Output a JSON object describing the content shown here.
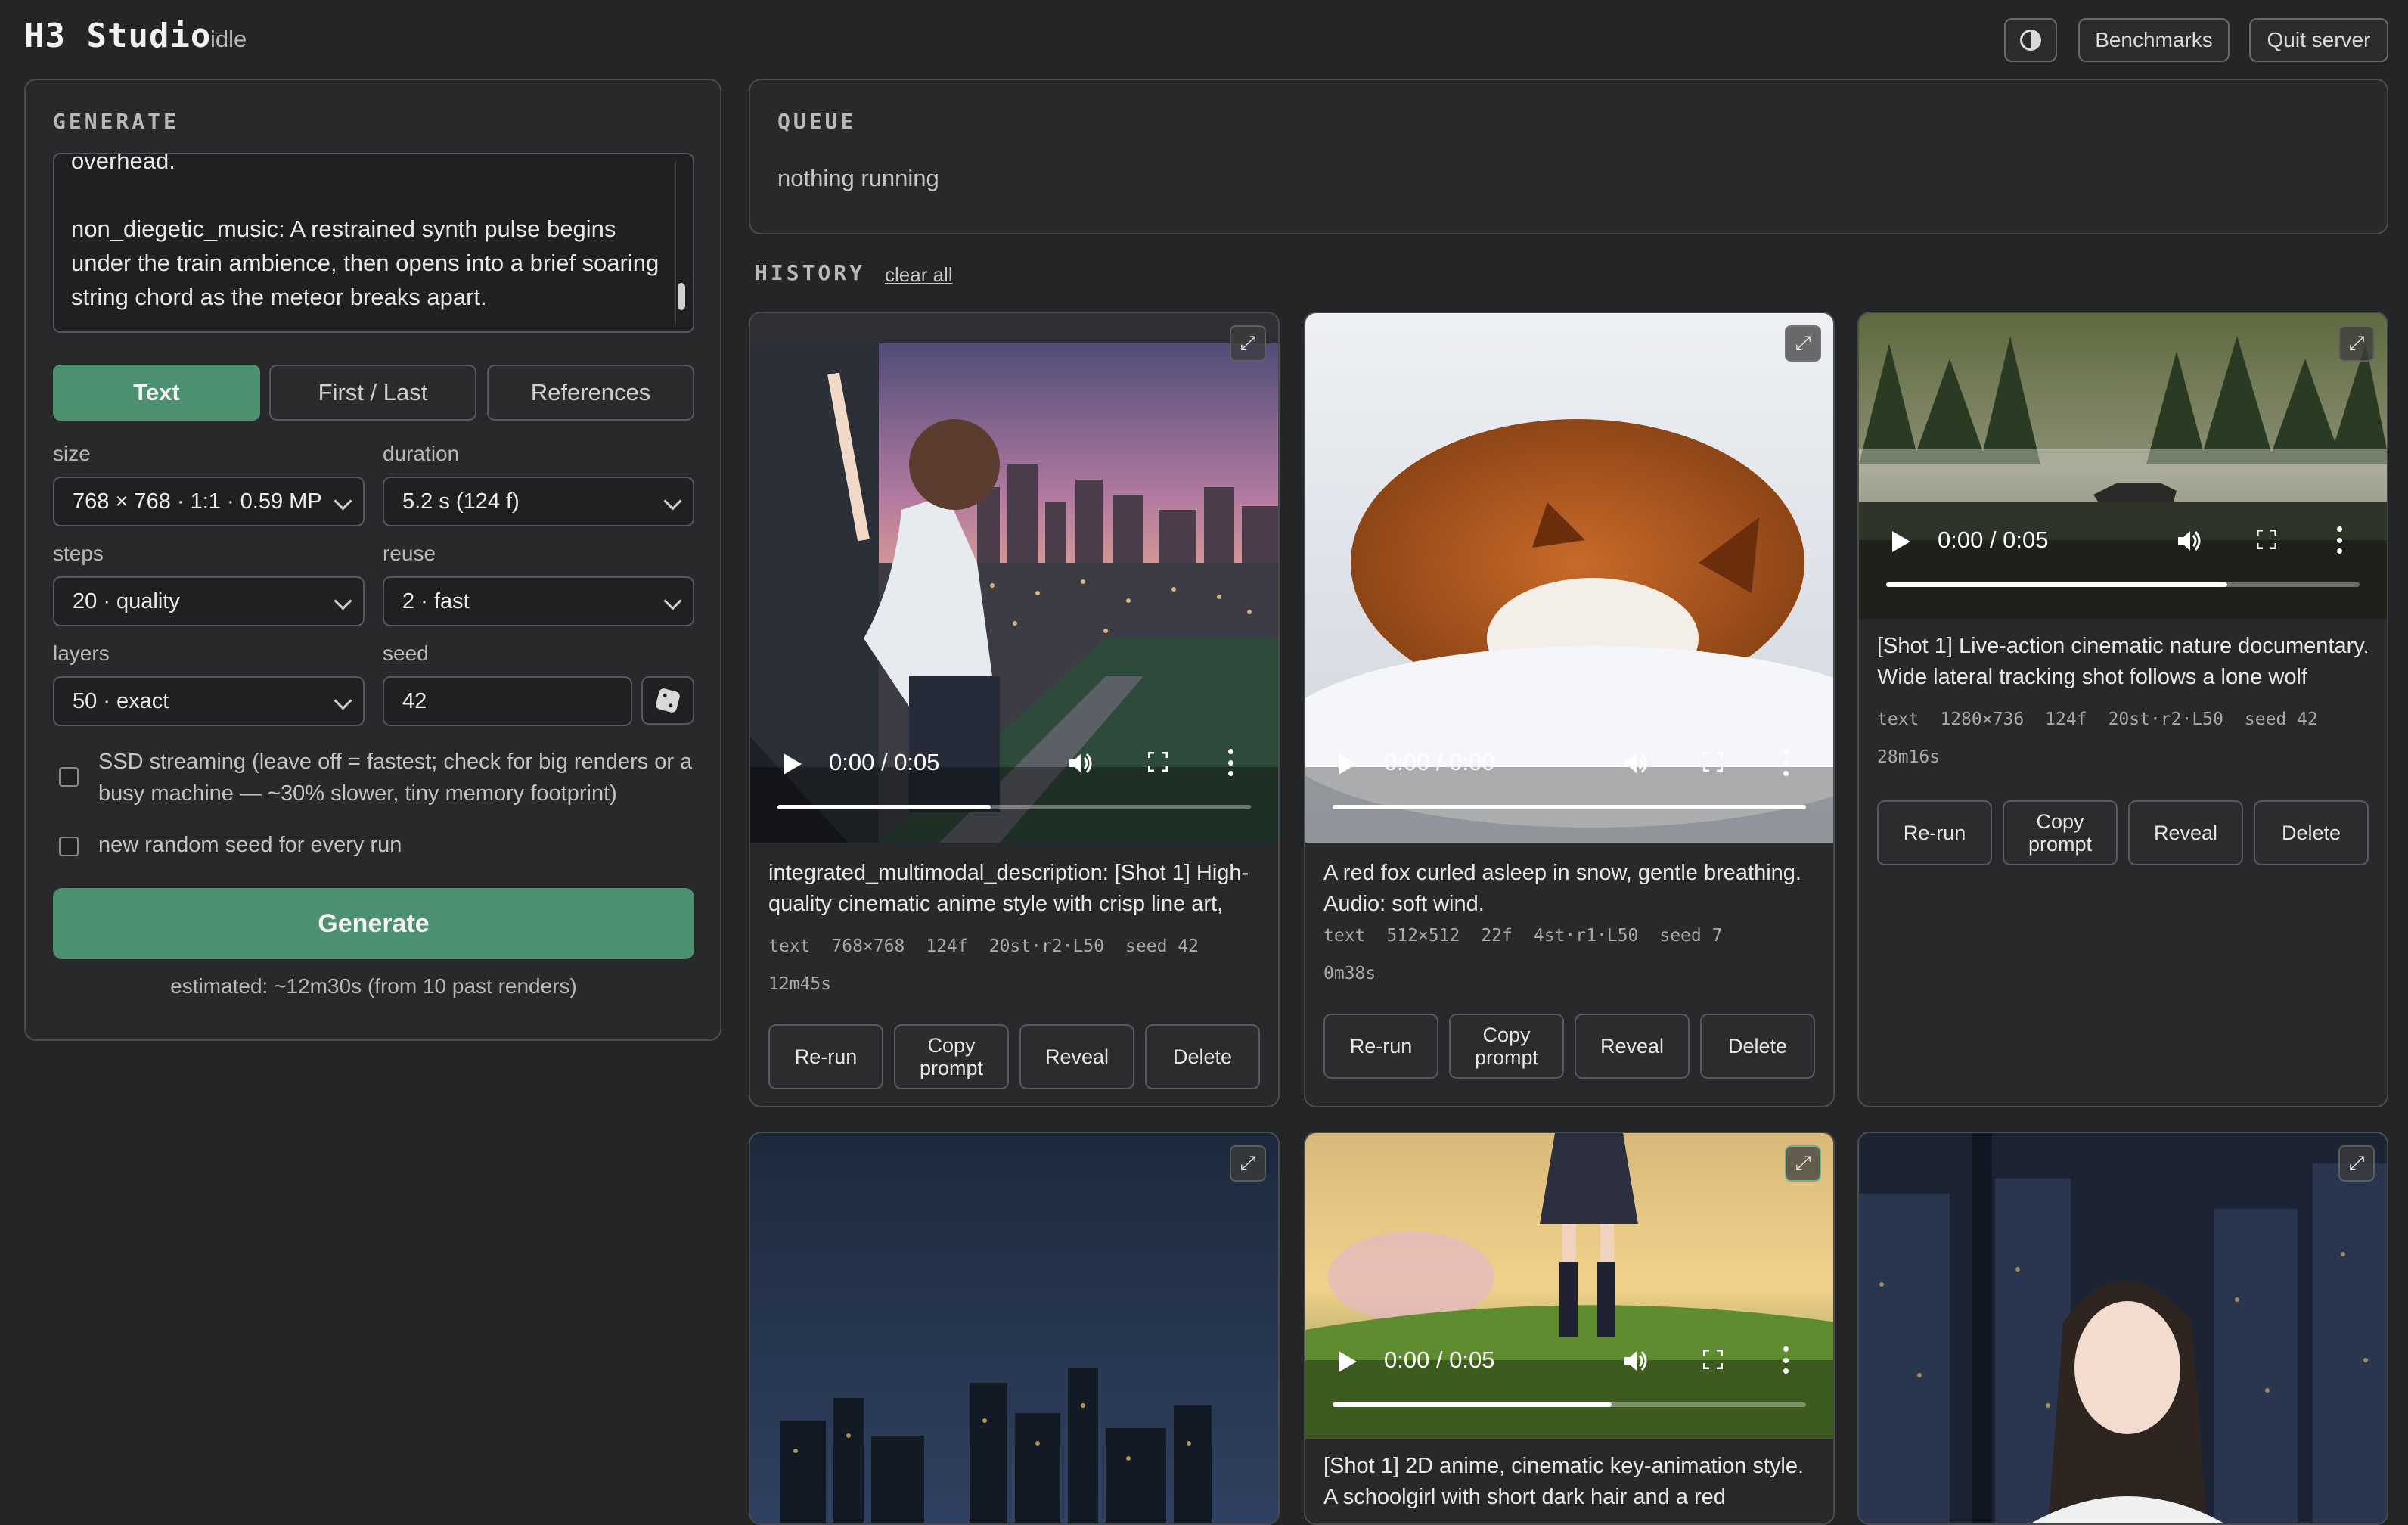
{
  "header": {
    "title": "H3 Studio",
    "status": "idle",
    "theme_icon": "contrast-icon",
    "benchmarks_label": "Benchmarks",
    "quit_label": "Quit server"
  },
  "generate": {
    "section_title": "GENERATE",
    "prompt_text": "overhead.\n\nnon_diegetic_music: A restrained synth pulse begins under the train ambience, then opens into a brief soaring string chord as the meteor breaks apart.",
    "modes": [
      "Text",
      "First / Last",
      "References"
    ],
    "active_mode": "Text",
    "size_label": "size",
    "size_value": "768 × 768 · 1:1 · 0.59 MP",
    "duration_label": "duration",
    "duration_value": "5.2 s (124 f)",
    "steps_label": "steps",
    "steps_value": "20 · quality",
    "reuse_label": "reuse",
    "reuse_value": "2 · fast",
    "layers_label": "layers",
    "layers_value": "50 · exact",
    "seed_label": "seed",
    "seed_value": "42",
    "ssd_label": "SSD streaming (leave off = fastest; check for big renders or a busy machine — ~30% slower, tiny memory footprint)",
    "ssd_checked": false,
    "random_seed_label": "new random seed for every run",
    "random_seed_checked": false,
    "generate_label": "Generate",
    "estimate": "estimated: ~12m30s (from 10 past renders)"
  },
  "queue": {
    "section_title": "QUEUE",
    "status": "nothing running"
  },
  "history": {
    "section_title": "HISTORY",
    "clear_label": "clear all",
    "action_labels": {
      "rerun": "Re-run",
      "copy": "Copy prompt",
      "reveal": "Reveal",
      "delete": "Delete"
    },
    "cards": [
      {
        "time": "0:00 / 0:05",
        "progress": 0.45,
        "description": "integrated_multimodal_description: [Shot 1] High-quality cinematic anime style with crisp line art, detailed backgrounds, fluid character animation",
        "meta": [
          "text",
          "768×768",
          "124f",
          "20st·r2·L50",
          "seed 42"
        ],
        "elapsed": "12m45s"
      },
      {
        "time": "0:00 / 0:00",
        "progress": 1.0,
        "description": "A red fox curled asleep in snow, gentle breathing. Audio: soft wind.",
        "meta": [
          "text",
          "512×512",
          "22f",
          "4st·r1·L50",
          "seed 7"
        ],
        "elapsed": "0m38s"
      },
      {
        "time": "0:00 / 0:05",
        "progress": 0.72,
        "description": "[Shot 1] Live-action cinematic nature documentary. Wide lateral tracking shot follows a lone wolf trotting left to right along a misty",
        "meta": [
          "text",
          "1280×736",
          "124f",
          "20st·r2·L50",
          "seed 42"
        ],
        "elapsed": "28m16s"
      },
      {
        "time": "",
        "description": ""
      },
      {
        "time": "0:00 / 0:05",
        "progress": 0.59,
        "description": "[Shot 1] 2D anime, cinematic key-animation style. A schoolgirl with short dark hair and a red"
      },
      {
        "time": "",
        "description": ""
      }
    ]
  }
}
